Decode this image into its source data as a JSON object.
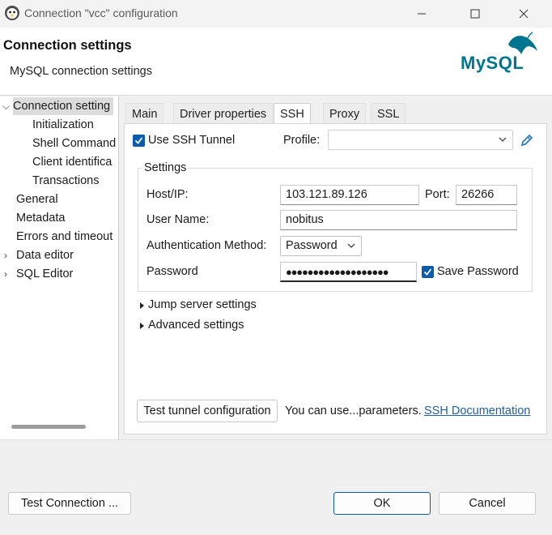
{
  "window": {
    "title": "Connection \"vcc\" configuration",
    "minimize_icon": "minimize-icon",
    "maximize_icon": "maximize-icon",
    "close_icon": "close-icon"
  },
  "header": {
    "title": "Connection settings",
    "subtitle": "MySQL connection settings",
    "logo_text": "MySQL"
  },
  "tree": {
    "items": [
      {
        "label": "Connection setting",
        "expanded": true,
        "selected": true
      },
      {
        "label": "Initialization"
      },
      {
        "label": "Shell Command"
      },
      {
        "label": "Client identifica"
      },
      {
        "label": "Transactions"
      },
      {
        "label": "General"
      },
      {
        "label": "Metadata"
      },
      {
        "label": "Errors and timeout"
      },
      {
        "label": "Data editor",
        "expandable": true
      },
      {
        "label": "SQL Editor",
        "expandable": true
      }
    ]
  },
  "tabs": [
    "Main",
    "Driver properties",
    "SSH",
    "Proxy",
    "SSL"
  ],
  "active_tab": "SSH",
  "ssh": {
    "use_tunnel_label": "Use SSH Tunnel",
    "use_tunnel_checked": true,
    "profile_label": "Profile:",
    "profile_value": "",
    "settings_title": "Settings",
    "host_label": "Host/IP:",
    "host_value": "103.121.89.126",
    "port_label": "Port:",
    "port_value": "26266",
    "user_label": "User Name:",
    "user_value": "nobitus",
    "auth_label": "Authentication Method:",
    "auth_value": "Password",
    "password_label": "Password",
    "password_mask": "●●●●●●●●●●●●●●●●●●●",
    "save_password_label": "Save Password",
    "save_password_checked": true,
    "jump_server_label": "Jump server settings",
    "advanced_label": "Advanced settings",
    "test_tunnel_label": "Test tunnel configuration",
    "hint_text": "You can use...parameters.",
    "doc_link": "SSH Documentation"
  },
  "footer": {
    "test_connection_label": "Test Connection ...",
    "ok_label": "OK",
    "cancel_label": "Cancel"
  },
  "colors": {
    "accent": "#0b5cad",
    "link": "#1a5fb4",
    "mysql_blue": "#00758f",
    "mysql_orange": "#f29111"
  }
}
